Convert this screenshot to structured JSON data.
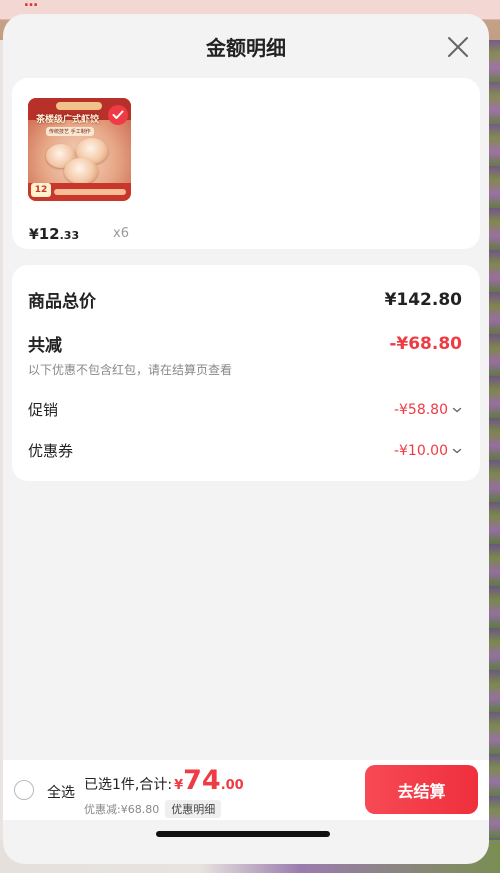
{
  "background": {
    "top_banner_text": "…"
  },
  "sheet": {
    "title": "金额明细"
  },
  "product": {
    "thumb": {
      "headline": "茶楼级广式虾饺",
      "subline": "传统技艺 手工制作",
      "price_tag": "12"
    },
    "price_yen": "¥",
    "price_int": "12",
    "price_dec": ".33",
    "quantity": "x6",
    "selected": true
  },
  "summary": {
    "total_label": "商品总价",
    "total_value": "¥142.80",
    "reduce_label": "共减",
    "reduce_value": "-¥68.80",
    "reduce_note": "以下优惠不包含红包，请在结算页查看",
    "promo_label": "促销",
    "promo_value": "-¥58.80",
    "coupon_label": "优惠券",
    "coupon_value": "-¥10.00"
  },
  "bottom_bar": {
    "select_all_label": "全选",
    "selected_text": "已选1件,合计:",
    "sum_yen": "¥",
    "sum_int": "74",
    "sum_dec": ".00",
    "discount_text": "优惠减:¥68.80",
    "detail_label": "优惠明细",
    "checkout_label": "去结算"
  },
  "colors": {
    "accent_red": "#ef3b44",
    "sheet_bg": "#f3f3f3",
    "card_bg": "#ffffff"
  },
  "icons": {
    "close": "close-icon",
    "check": "check-icon",
    "chevron": "chevron-down-icon"
  }
}
